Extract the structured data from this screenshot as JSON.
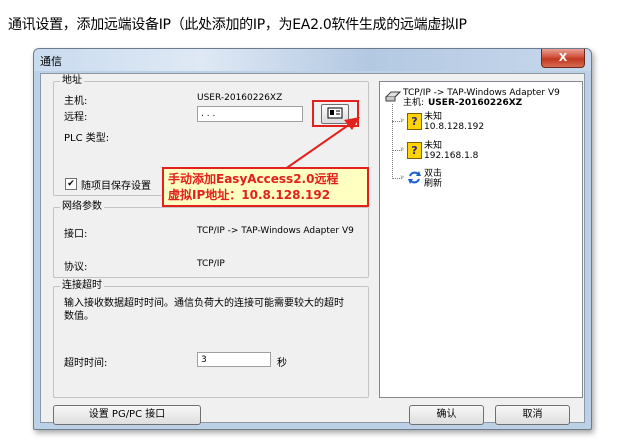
{
  "heading": "通讯设置，添加远端设备IP（此处添加的IP，为EA2.0软件生成的远端虚拟IP",
  "window": {
    "title": "通信",
    "close_glyph": "X"
  },
  "address": {
    "legend": "地址",
    "host_label": "主机:",
    "host_value": "USER-20160226XZ",
    "remote_label": "远程:",
    "remote_value": "   .    .    .",
    "plc_label": "PLC 类型:"
  },
  "save_settings": {
    "label": "随项目保存设置",
    "checked_glyph": "✔"
  },
  "callout": {
    "line1": "手动添加EasyAccess2.0远程",
    "line2": "虚拟IP地址：10.8.128.192"
  },
  "network": {
    "legend": "网络参数",
    "interface_label": "接口:",
    "interface_value": "TCP/IP -> TAP-Windows Adapter V9",
    "protocol_label": "协议:",
    "protocol_value": "TCP/IP"
  },
  "timeout": {
    "legend": "连接超时",
    "description": "输入接收数据超时时间。通信负荷大的连接可能需要较大的超时数值。",
    "label": "超时时间:",
    "value": "3",
    "unit": "秒"
  },
  "buttons": {
    "set_pgpc": "设置 PG/PC 接口",
    "ok": "确认",
    "cancel": "取消"
  },
  "tree": {
    "root_line1": "TCP/IP -> TAP-Windows Adapter V9",
    "root_line2_prefix": "主机:",
    "root_line2_host": "USER-20160226XZ",
    "nodes": [
      {
        "name": "未知",
        "ip": "10.8.128.192"
      },
      {
        "name": "未知",
        "ip": "192.168.1.8"
      }
    ],
    "refresh_line1": "双击",
    "refresh_line2": "刷新"
  },
  "colors": {
    "highlight": "#e3201b",
    "callout_bg": "#ffffc2",
    "window_frame": "#bcd0e6"
  }
}
